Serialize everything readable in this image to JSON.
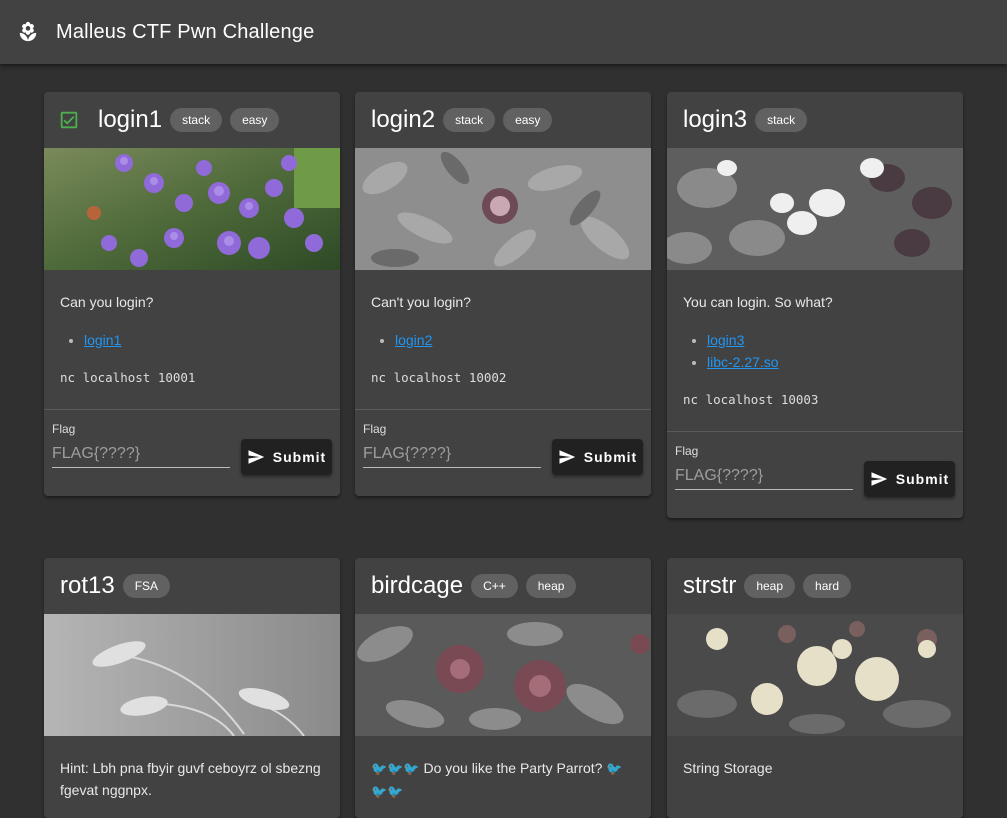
{
  "app": {
    "title": "Malleus CTF Pwn Challenge"
  },
  "flag_form": {
    "label": "Flag",
    "placeholder": "FLAG{????}",
    "submit_label": "Submit"
  },
  "cards": [
    {
      "title": "login1",
      "solved": true,
      "tags": [
        "stack",
        "easy"
      ],
      "description": "Can you login?",
      "links": [
        "login1"
      ],
      "nc": "nc localhost 10001"
    },
    {
      "title": "login2",
      "solved": false,
      "tags": [
        "stack",
        "easy"
      ],
      "description": "Can't you login?",
      "links": [
        "login2"
      ],
      "nc": "nc localhost 10002"
    },
    {
      "title": "login3",
      "solved": false,
      "tags": [
        "stack"
      ],
      "description": "You can login. So what?",
      "links": [
        "login3",
        "libc-2.27.so"
      ],
      "nc": "nc localhost 10003"
    },
    {
      "title": "rot13",
      "solved": false,
      "tags": [
        "FSA"
      ],
      "description": "Hint: Lbh pna fbyir guvf ceboyrz ol sbezng fgevat nggnpx."
    },
    {
      "title": "birdcage",
      "solved": false,
      "tags": [
        "C++",
        "heap"
      ],
      "description": "Do you like the Party Parrot?"
    },
    {
      "title": "strstr",
      "solved": false,
      "tags": [
        "heap",
        "hard"
      ],
      "description": "String Storage"
    }
  ],
  "colors": {
    "appbar": "#424242",
    "background": "#303030",
    "card": "#424242",
    "link": "#2196f3",
    "check": "#4caf50"
  }
}
